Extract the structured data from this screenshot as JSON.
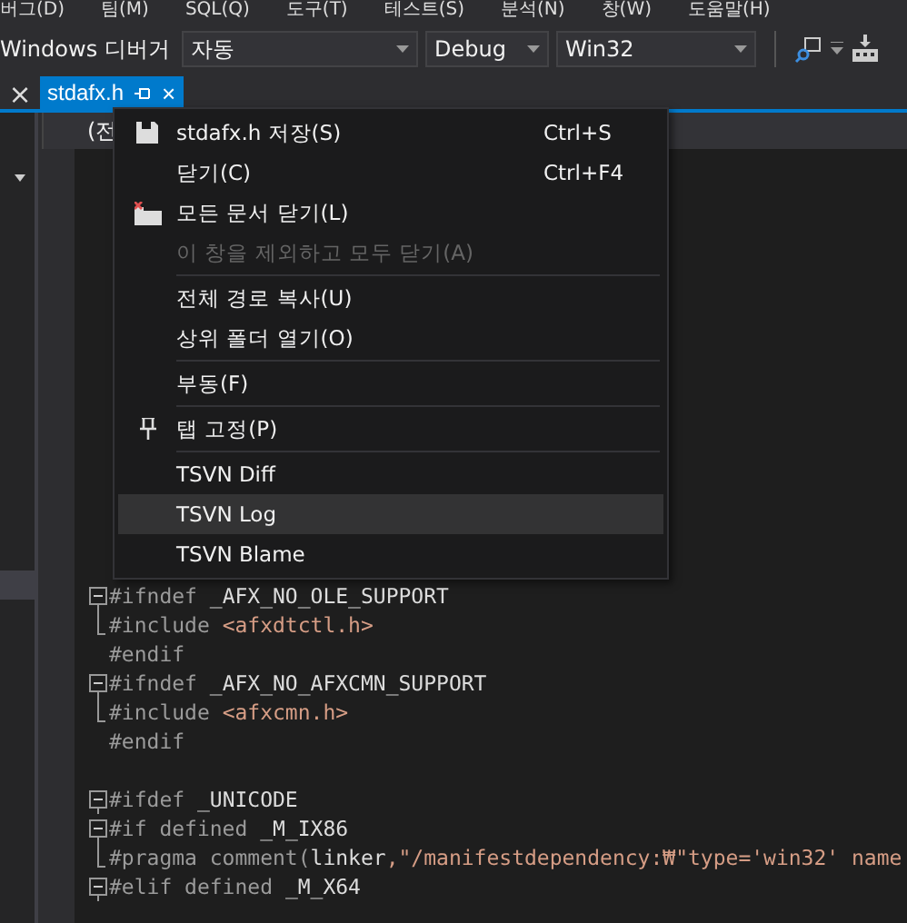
{
  "menu_bar": [
    "버그(D)",
    "팀(M)",
    "SQL(Q)",
    "도구(T)",
    "테스트(S)",
    "분석(N)",
    "창(W)",
    "도움말(H)"
  ],
  "toolbar": {
    "debugger": "Windows 디버거",
    "combos": [
      "자동",
      "Debug",
      "Win32"
    ]
  },
  "tab": {
    "title": "stdafx.h",
    "close": "×",
    "selected": true
  },
  "panel_close": "×",
  "nav_bar": {
    "scope": "(전"
  },
  "context_menu": [
    {
      "kind": "item",
      "label": "stdafx.h 저장(S)",
      "shortcut": "Ctrl+S",
      "disabled": false,
      "selected": false
    },
    {
      "kind": "item",
      "label": "닫기(C)",
      "shortcut": "Ctrl+F4",
      "disabled": false,
      "selected": false
    },
    {
      "kind": "item",
      "label": "모든 문서 닫기(L)",
      "disabled": false,
      "selected": false
    },
    {
      "kind": "item",
      "label": "이 창을 제외하고 모두 닫기(A)",
      "disabled": true,
      "selected": false
    },
    {
      "kind": "separator"
    },
    {
      "kind": "item",
      "label": "전체 경로 복사(U)",
      "disabled": false,
      "selected": false
    },
    {
      "kind": "item",
      "label": "상위 폴더 열기(O)",
      "disabled": false,
      "selected": false
    },
    {
      "kind": "separator"
    },
    {
      "kind": "item",
      "label": "부동(F)",
      "disabled": false,
      "selected": false
    },
    {
      "kind": "separator"
    },
    {
      "kind": "item",
      "label": "탭 고정(P)",
      "disabled": false,
      "selected": false
    },
    {
      "kind": "separator"
    },
    {
      "kind": "item",
      "label": "TSVN Diff",
      "disabled": false,
      "selected": false
    },
    {
      "kind": "item",
      "label": "TSVN Log",
      "disabled": false,
      "selected": true
    },
    {
      "kind": "item",
      "label": "TSVN Blame",
      "disabled": false,
      "selected": false
    }
  ],
  "code_lines": [
    {
      "kind": "fold_start",
      "tokens": [
        {
          "text": "#ifndef",
          "kind": "directive"
        },
        {
          "text": " _AFX_NO_OLE_SUPPORT",
          "kind": "macro"
        }
      ]
    },
    {
      "kind": "fold_body",
      "tokens": [
        {
          "text": "#include",
          "kind": "directive"
        },
        {
          "text": " <afxdtctl.h>",
          "kind": "string"
        }
      ]
    },
    {
      "kind": "plain",
      "tokens": [
        {
          "text": "#endif",
          "kind": "directive"
        }
      ]
    },
    {
      "kind": "fold_start",
      "tokens": [
        {
          "text": "#ifndef",
          "kind": "directive"
        },
        {
          "text": " _AFX_NO_AFXCMN_SUPPORT",
          "kind": "macro"
        }
      ]
    },
    {
      "kind": "fold_body",
      "tokens": [
        {
          "text": "#include",
          "kind": "directive"
        },
        {
          "text": " <afxcmn.h>",
          "kind": "string"
        }
      ]
    },
    {
      "kind": "plain",
      "tokens": [
        {
          "text": "#endif",
          "kind": "directive"
        }
      ]
    },
    {
      "kind": "plain"
    },
    {
      "kind": "fold_start",
      "tokens": [
        {
          "text": "#ifdef",
          "kind": "directive"
        },
        {
          "text": " _UNICODE",
          "kind": "macro"
        }
      ]
    },
    {
      "kind": "fold_start",
      "tokens": [
        {
          "text": "#if defined",
          "kind": "directive"
        },
        {
          "text": " _M_IX86",
          "kind": "macro"
        }
      ]
    },
    {
      "kind": "fold_body",
      "tokens": [
        {
          "text": "#pragma comment(",
          "kind": "directive"
        },
        {
          "text": "linker",
          "kind": "macro"
        },
        {
          "text": ",\"/manifestdependency:₩\"type='win32' name",
          "kind": "string"
        }
      ]
    },
    {
      "kind": "fold_start",
      "tokens": [
        {
          "text": "#elif defined",
          "kind": "directive"
        },
        {
          "text": " _M_X64",
          "kind": "macro"
        }
      ]
    }
  ]
}
